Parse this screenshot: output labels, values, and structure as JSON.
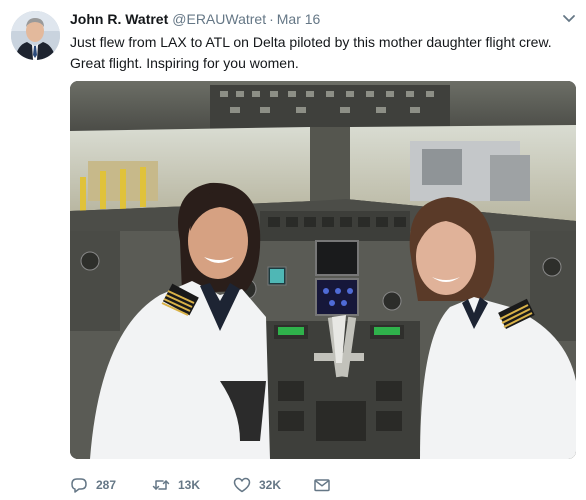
{
  "tweet": {
    "author_name": "John R. Watret",
    "author_handle": "@ERAUWatret",
    "separator": "·",
    "date": "Mar 16",
    "text_line1": "Just flew from LAX to ATL on Delta piloted by this mother daughter flight crew.",
    "text_line2": "Great flight. Inspiring for you women."
  },
  "actions": {
    "replies": "287",
    "retweets": "13K",
    "likes": "32K"
  },
  "icons": {
    "reply": "reply-icon",
    "retweet": "retweet-icon",
    "like": "heart-icon",
    "message": "envelope-icon",
    "more": "chevron-down-icon"
  },
  "colors": {
    "name": "#14171a",
    "secondary": "#657786",
    "background": "#ffffff"
  }
}
